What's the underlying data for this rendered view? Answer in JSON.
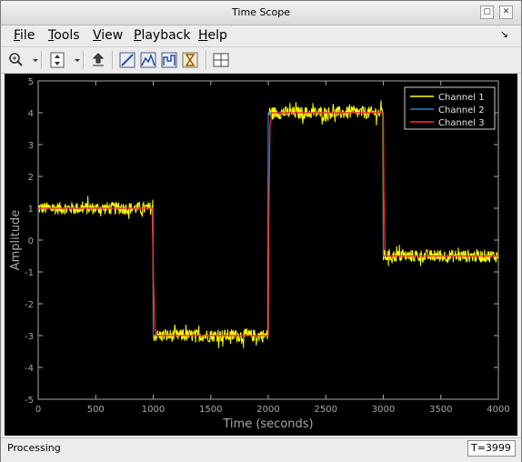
{
  "window": {
    "title": "Time Scope"
  },
  "menu": [
    {
      "label": "File",
      "accel": "F",
      "rest": "ile"
    },
    {
      "label": "Tools",
      "accel": "T",
      "rest": "ools"
    },
    {
      "label": "View",
      "accel": "V",
      "rest": "iew"
    },
    {
      "label": "Playback",
      "accel": "P",
      "rest": "layback"
    },
    {
      "label": "Help",
      "accel": "H",
      "rest": "elp"
    }
  ],
  "toolbar": {
    "icons": [
      "zoom-icon",
      "dropdown-arrow-icon",
      "scale-axes-icon",
      "dropdown-arrow-icon",
      "export-icon",
      "cursor-measure-icon",
      "peak-finder-icon",
      "signal-stats-icon",
      "bilevel-icon",
      "layout-icon"
    ]
  },
  "status": {
    "text": "Processing",
    "time": "T=3999"
  },
  "colors": {
    "channel1": "#ffff00",
    "channel2": "#2f7bd8",
    "channel3": "#ff2a2a",
    "plot_bg": "#000000",
    "axis": "#a8a8a8"
  },
  "chart_data": {
    "type": "line",
    "title": "",
    "xlabel": "Time (seconds)",
    "ylabel": "Amplitude",
    "xlim": [
      0,
      4000
    ],
    "ylim": [
      -5,
      5
    ],
    "xticks": [
      0,
      500,
      1000,
      1500,
      2000,
      2500,
      3000,
      3500,
      4000
    ],
    "yticks": [
      5,
      4,
      3,
      2,
      1,
      0,
      -1,
      -2,
      -3,
      -4,
      -5
    ],
    "legend_position": "top-right",
    "series": [
      {
        "name": "Channel 1",
        "noisy": true,
        "noise_amplitude": 0.2,
        "x": [
          0,
          1000,
          1000,
          2000,
          2000,
          3000,
          3000,
          4000
        ],
        "y": [
          1,
          1,
          -3,
          -3,
          4,
          4,
          -0.5,
          -0.5
        ]
      },
      {
        "name": "Channel 2",
        "x": [
          0,
          1000,
          1000,
          2000,
          2000,
          3000,
          3000,
          4000
        ],
        "y": [
          1,
          1,
          -3,
          -3,
          4,
          4,
          -0.5,
          -0.5
        ]
      },
      {
        "name": "Channel 3",
        "x": [
          0,
          990,
          1005,
          1015,
          1030,
          2000,
          2005,
          2015,
          2030,
          3000,
          3005,
          3015,
          3030,
          4000
        ],
        "y": [
          1,
          1,
          -1.6,
          -2.8,
          -3,
          -3,
          0.5,
          3.6,
          4,
          4,
          1.6,
          -0.3,
          -0.5,
          -0.5
        ]
      }
    ]
  }
}
